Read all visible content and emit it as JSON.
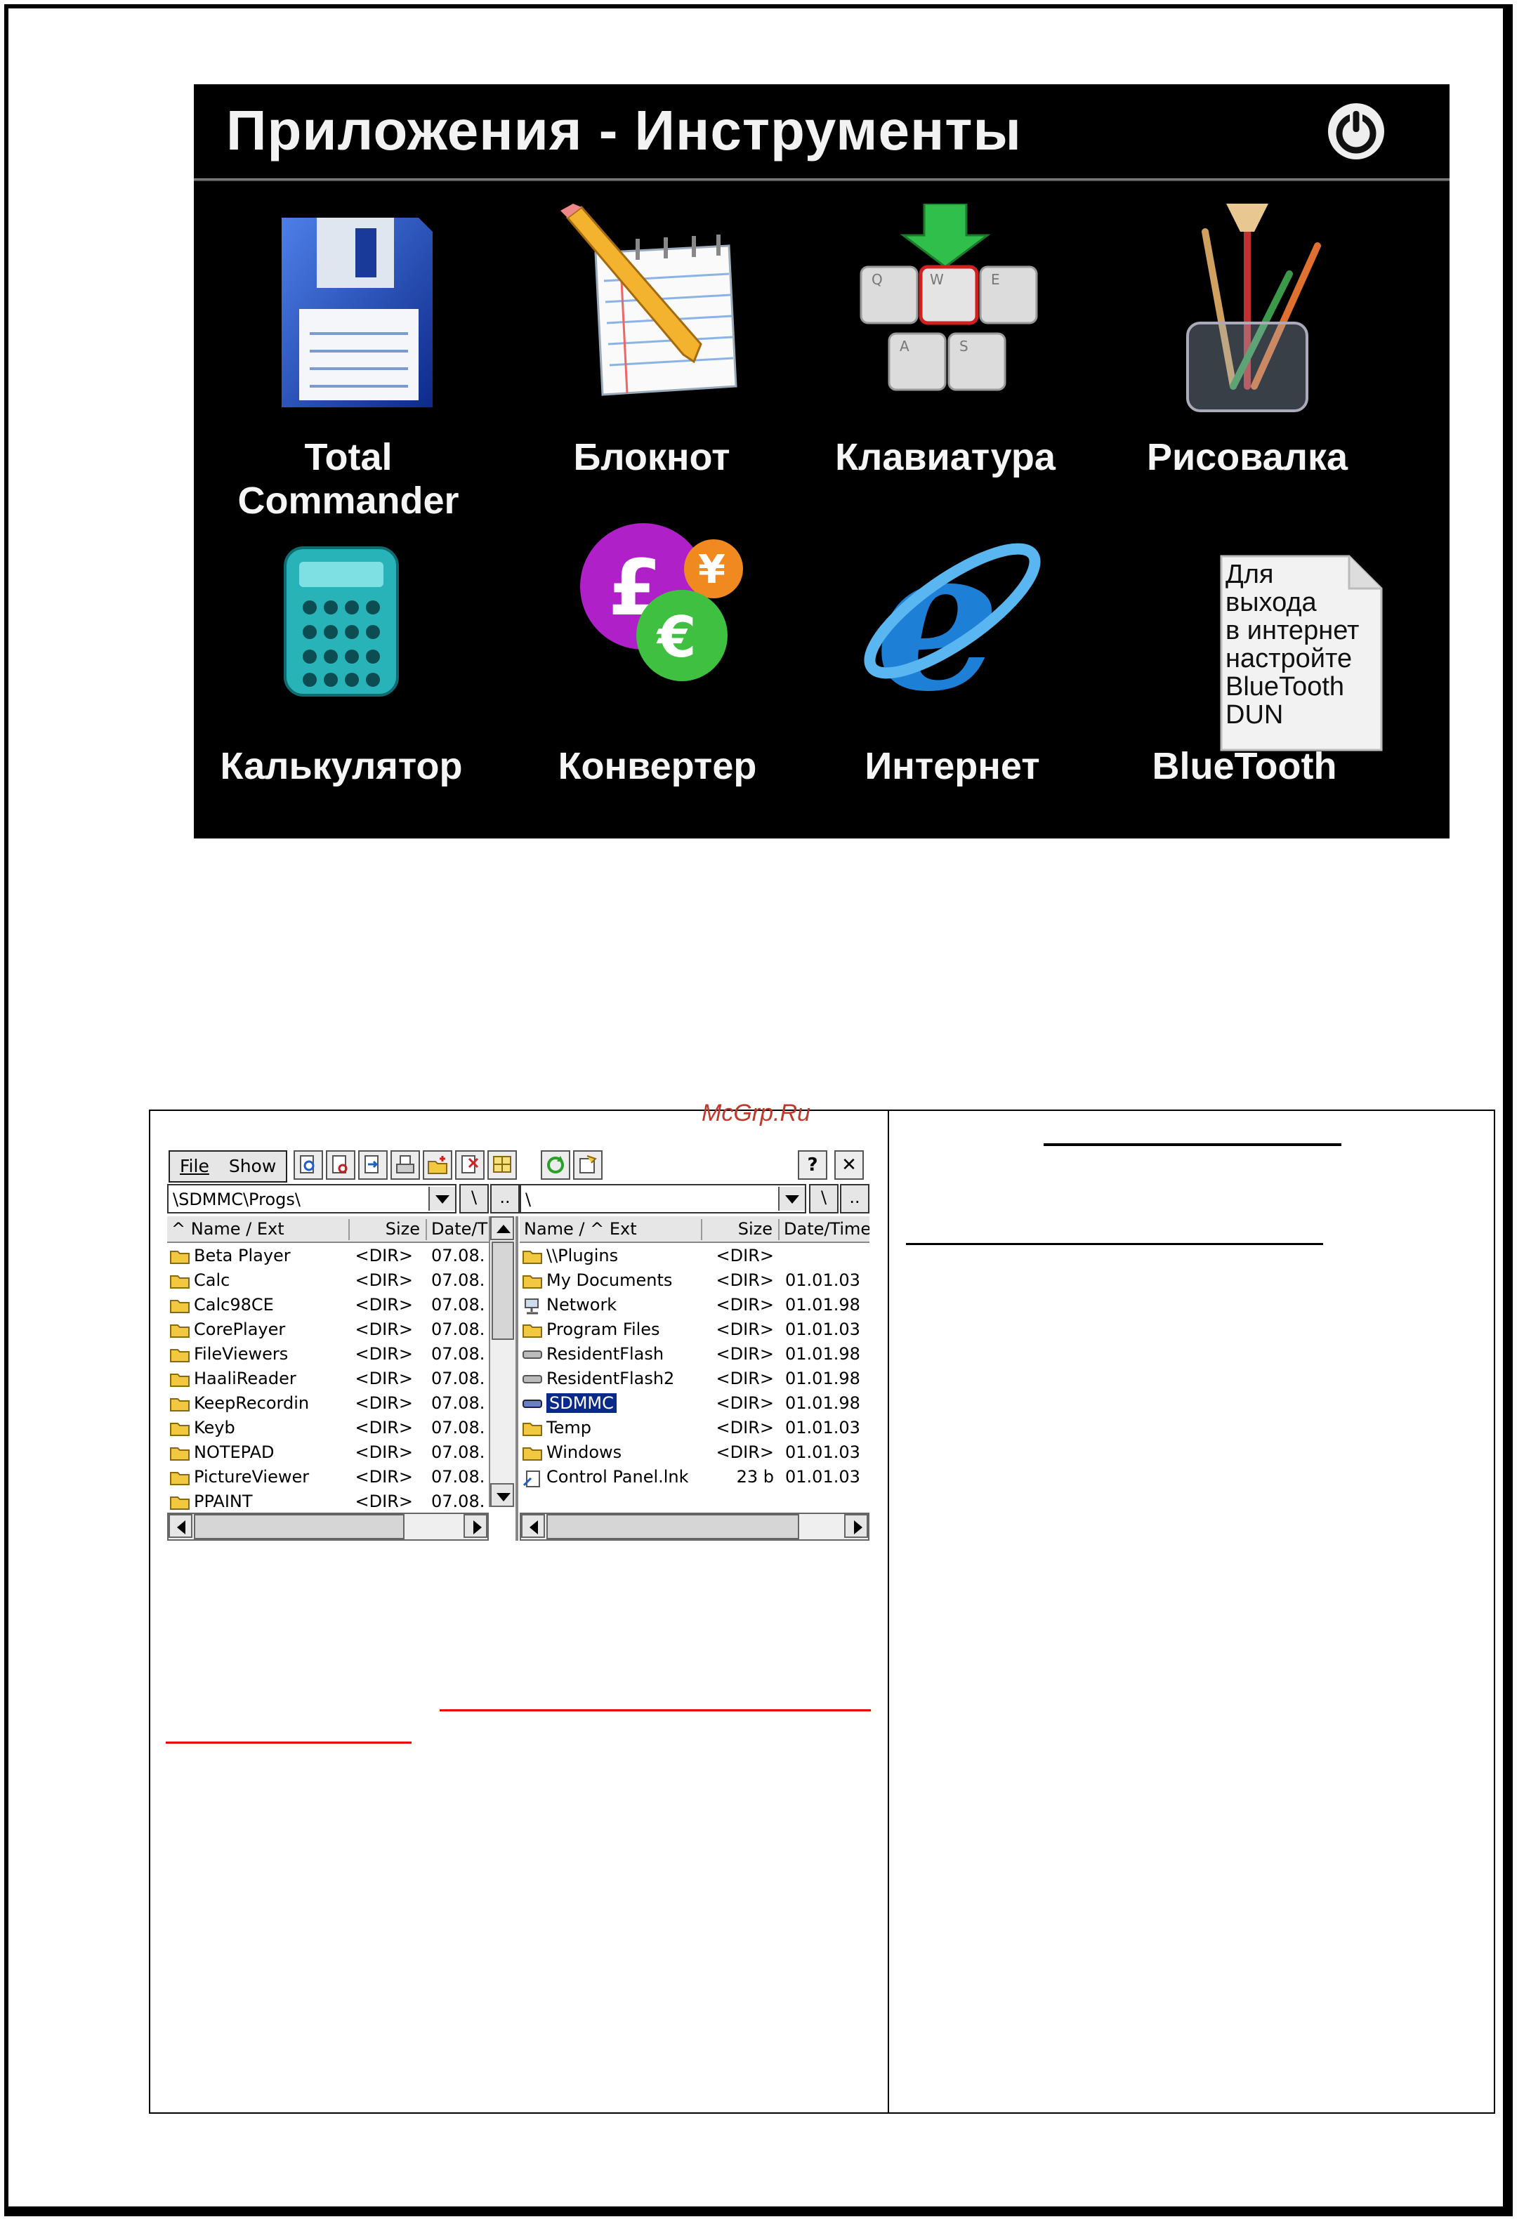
{
  "watermark": "McGrp.Ru",
  "apps_screen": {
    "title": "Приложения  - Инструменты",
    "tiles": [
      {
        "label": "Total Commander",
        "icon": "floppy-disk-icon"
      },
      {
        "label": "Блокнот",
        "icon": "notepad-pencil-icon"
      },
      {
        "label": "Клавиатура",
        "icon": "keyboard-keys-icon"
      },
      {
        "label": "Рисовалка",
        "icon": "paint-brushes-icon"
      },
      {
        "label": "Калькулятор",
        "icon": "calculator-icon"
      },
      {
        "label": "Конвертер",
        "icon": "currency-converter-icon"
      },
      {
        "label": "Интернет",
        "icon": "internet-explorer-icon"
      },
      {
        "label": "BlueTooth",
        "icon": "bluetooth-note-icon"
      }
    ],
    "bluetooth_note": "Для\nвыхода\nв интернет\nнастройте\nBlueTooth\nDUN"
  },
  "total_commander": {
    "menu": {
      "file": "File",
      "show": "Show"
    },
    "help_label": "?",
    "close_label": "✕",
    "left_panel": {
      "path": "\\SDMMC\\Progs\\",
      "root_label": "\\",
      "up_label": "..",
      "headers": {
        "name": "^ Name / Ext",
        "size": "Size",
        "date": "Date/T"
      },
      "rows": [
        {
          "name": "Beta Player",
          "size": "<DIR>",
          "date": "07.08."
        },
        {
          "name": "Calc",
          "size": "<DIR>",
          "date": "07.08."
        },
        {
          "name": "Calc98CE",
          "size": "<DIR>",
          "date": "07.08."
        },
        {
          "name": "CorePlayer",
          "size": "<DIR>",
          "date": "07.08."
        },
        {
          "name": "FileViewers",
          "size": "<DIR>",
          "date": "07.08."
        },
        {
          "name": "HaaliReader",
          "size": "<DIR>",
          "date": "07.08."
        },
        {
          "name": "KeepRecordin",
          "size": "<DIR>",
          "date": "07.08."
        },
        {
          "name": "Keyb",
          "size": "<DIR>",
          "date": "07.08."
        },
        {
          "name": "NOTEPAD",
          "size": "<DIR>",
          "date": "07.08."
        },
        {
          "name": "PictureViewer",
          "size": "<DIR>",
          "date": "07.08."
        },
        {
          "name": "PPAINT",
          "size": "<DIR>",
          "date": "07.08."
        }
      ]
    },
    "right_panel": {
      "path": "\\",
      "root_label": "\\",
      "up_label": "..",
      "headers": {
        "name": "Name / ^ Ext",
        "size": "Size",
        "date": "Date/Time"
      },
      "rows": [
        {
          "name": "\\\\Plugins",
          "size": "<DIR>",
          "date": "",
          "kind": "folder"
        },
        {
          "name": "My Documents",
          "size": "<DIR>",
          "date": "01.01.03",
          "kind": "folder"
        },
        {
          "name": "Network",
          "size": "<DIR>",
          "date": "01.01.98",
          "kind": "network"
        },
        {
          "name": "Program Files",
          "size": "<DIR>",
          "date": "01.01.03",
          "kind": "folder"
        },
        {
          "name": "ResidentFlash",
          "size": "<DIR>",
          "date": "01.01.98",
          "kind": "drive"
        },
        {
          "name": "ResidentFlash2",
          "size": "<DIR>",
          "date": "01.01.98",
          "kind": "drive"
        },
        {
          "name": "SDMMC",
          "size": "<DIR>",
          "date": "01.01.98",
          "kind": "card",
          "selected": true
        },
        {
          "name": "Temp",
          "size": "<DIR>",
          "date": "01.01.03",
          "kind": "folder"
        },
        {
          "name": "Windows",
          "size": "<DIR>",
          "date": "01.01.03",
          "kind": "folder"
        },
        {
          "name": "Control Panel.lnk",
          "size": "23 b",
          "date": "01.01.03",
          "kind": "link"
        }
      ]
    }
  }
}
